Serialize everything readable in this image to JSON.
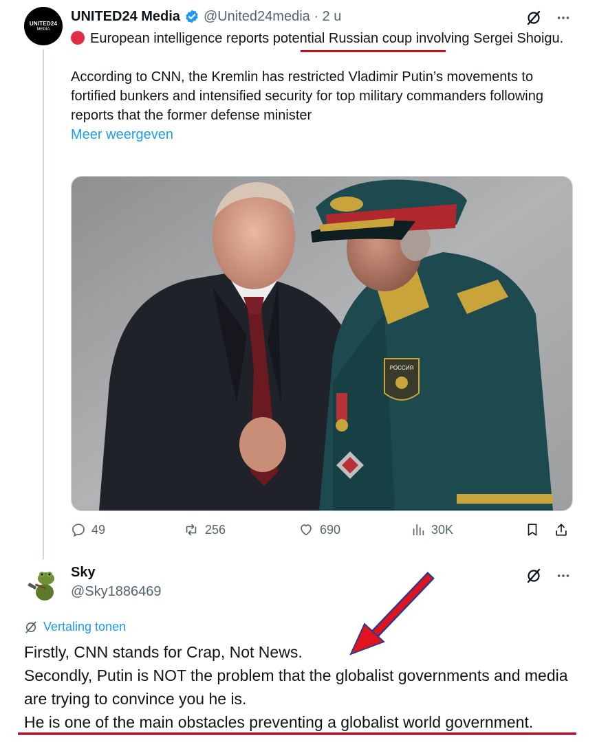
{
  "tweet": {
    "avatar_text_line1": "UNITED24",
    "avatar_text_line2": "MEDIA",
    "author_name": "UNITED24 Media",
    "handle_time": "@United24media · 2 u",
    "headline": "European intelligence reports potential Russian coup involving Sergei Shoigu.",
    "body": "According to CNN, the Kremlin has restricted Vladimir Putin’s movements to fortified bunkers and intensified security for top military commanders following reports that the former defense minister",
    "show_more": "Meer weergeven",
    "stats": {
      "replies": "49",
      "reposts": "256",
      "likes": "690",
      "views": "30K"
    }
  },
  "photo": {
    "insignia_text": "РОССИЯ"
  },
  "reply": {
    "author_name": "Sky",
    "handle": "@Sky1886469",
    "translate_label": "Vertaling tonen",
    "lines": [
      "Firstly, CNN stands for Crap, Not News.",
      "Secondly, Putin is NOT the problem that the globalist governments and media are trying to convince you he is.",
      "He is one of the main obstacles preventing a globalist world government."
    ]
  },
  "colors": {
    "link_blue": "#1d9bf0",
    "muted_text": "#536471",
    "annotation_red": "#d0101f"
  }
}
